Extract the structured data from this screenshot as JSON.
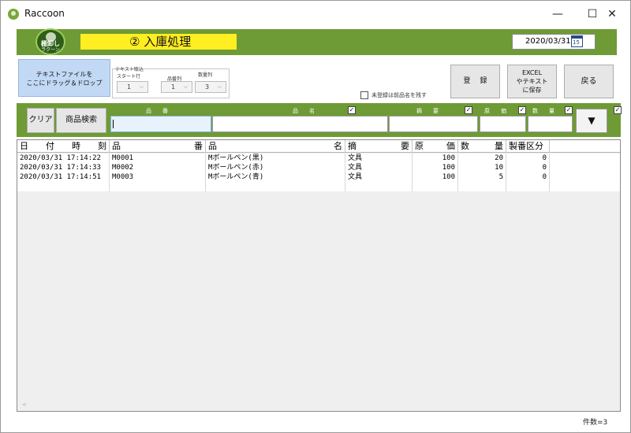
{
  "window": {
    "title": "Raccoon",
    "minimize_glyph": "—",
    "maximize_glyph": "☐",
    "close_glyph": "✕"
  },
  "header": {
    "logo_line1": "棚卸し",
    "logo_line2": "ラクーン",
    "screen_title": "② 入庫処理",
    "date": "2020/03/31",
    "calendar_day": "15"
  },
  "controls": {
    "drop_zone_line1": "テキストファイルを",
    "drop_zone_line2": "ここにドラッグ＆ドロップ",
    "import_label": "テキスト取込",
    "start_row_label": "スタート行",
    "start_row_value": "1",
    "code_col_label": "品番列",
    "code_col_value": "1",
    "qty_col_label": "数量列",
    "qty_col_value": "3",
    "keep_label": "未登録は前品名を残す",
    "register_label": "登録",
    "excel_line1": "EXCEL",
    "excel_line2": "やテキスト",
    "excel_line3": "に保存",
    "back_label": "戻る"
  },
  "search": {
    "clear_label": "クリア",
    "product_search_label": "商品検索",
    "code_label": "品　　番",
    "name_label": "品　　名",
    "note_label": "摘　　要",
    "cost_label": "原　　価",
    "qty_label": "数　　量",
    "check_mark": "✓",
    "dropdown_glyph": "▼"
  },
  "grid": {
    "columns": [
      "日　付　時　刻",
      "品　　　　番",
      "品　　　　　名",
      "摘　　　　要",
      "原　　価",
      "数　　量",
      "製番区分"
    ],
    "rows": [
      [
        "2020/03/31 17:14:22",
        "M0001",
        "Mボールペン(黒)",
        "文具",
        "100",
        "20",
        "0"
      ],
      [
        "2020/03/31 17:14:33",
        "M0002",
        "Mボールペン(赤)",
        "文具",
        "100",
        "10",
        "0"
      ],
      [
        "2020/03/31 17:14:51",
        "M0003",
        "Mボールペン(青)",
        "文具",
        "100",
        "5",
        "0"
      ]
    ]
  },
  "status": {
    "count_text": "件数=3"
  },
  "colors": {
    "accent_green": "#6e9b35",
    "title_yellow": "#ffee22",
    "drop_zone_blue": "#c2d9f5"
  }
}
